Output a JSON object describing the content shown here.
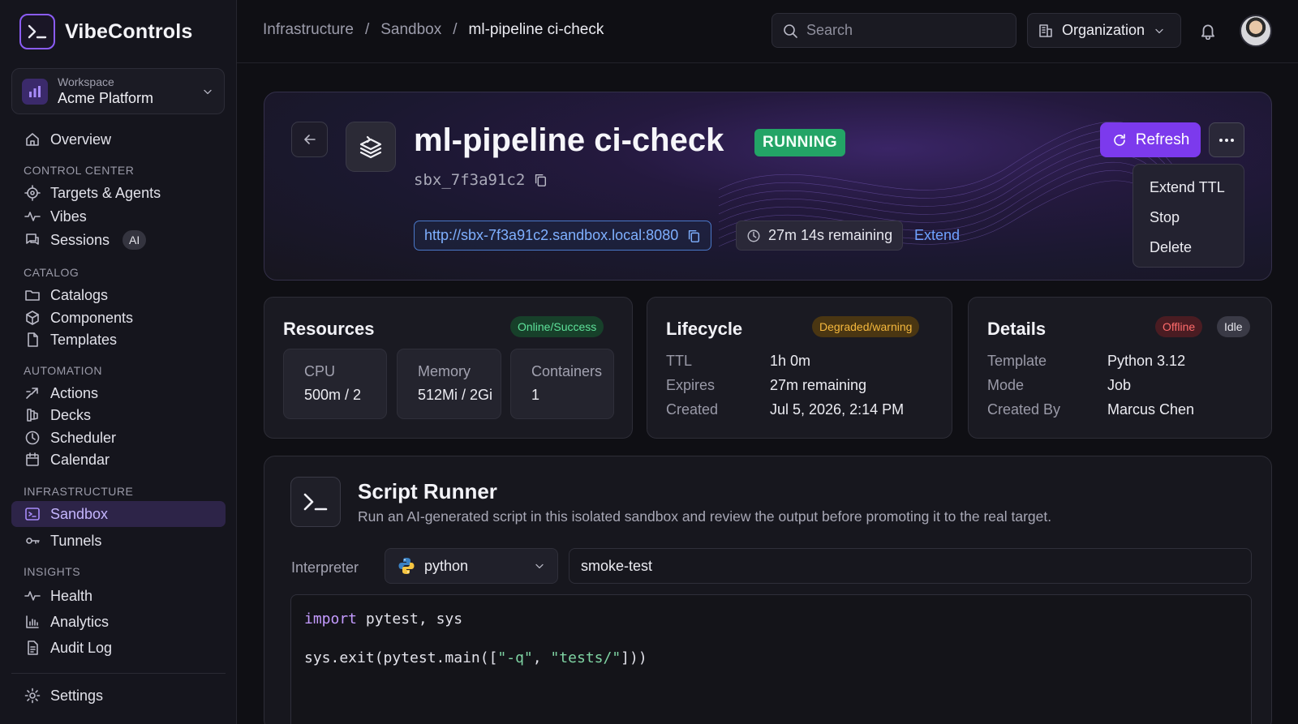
{
  "app": {
    "name": "VibeControls"
  },
  "workspace": {
    "label": "Workspace",
    "name": "Acme Platform"
  },
  "nav": {
    "overview": "Overview",
    "sections": {
      "control_center": "CONTROL CENTER",
      "catalog": "CATALOG",
      "automation": "AUTOMATION",
      "infrastructure": "INFRASTRUCTURE",
      "insights": "INSIGHTS"
    },
    "items": {
      "targets": "Targets & Agents",
      "vibes": "Vibes",
      "sessions": "Sessions",
      "sessions_badge": "AI",
      "catalogs": "Catalogs",
      "components": "Components",
      "templates": "Templates",
      "actions": "Actions",
      "decks": "Decks",
      "scheduler": "Scheduler",
      "calendar": "Calendar",
      "sandbox": "Sandbox",
      "tunnels": "Tunnels",
      "health": "Health",
      "analytics": "Analytics",
      "audit_log": "Audit Log",
      "settings": "Settings"
    }
  },
  "breadcrumb": [
    "Infrastructure",
    "Sandbox",
    "ml-pipeline ci-check"
  ],
  "breadcrumb_sep": "/",
  "search": {
    "placeholder": "Search"
  },
  "org": {
    "label": "Organization"
  },
  "sandbox": {
    "title": "ml-pipeline ci-check",
    "status": "RUNNING",
    "id": "sbx_7f3a91c2",
    "url": "http://sbx-7f3a91c2.sandbox.local:8080",
    "remaining": "27m 14s remaining",
    "extend": "Extend",
    "refresh": "Refresh",
    "menu": [
      "Extend TTL",
      "Stop",
      "Delete"
    ]
  },
  "resources": {
    "title": "Resources",
    "badge": "Online/Success",
    "cpu_label": "CPU",
    "cpu_value": "500m / 2",
    "memory_label": "Memory",
    "memory_value": "512Mi / 2Gi",
    "containers_label": "Containers",
    "containers_value": "1"
  },
  "lifecycle": {
    "title": "Lifecycle",
    "badge": "Degraded/warning",
    "ttl_label": "TTL",
    "ttl_value": "1h 0m",
    "expires_label": "Expires",
    "expires_value": "27m remaining",
    "created_label": "Created",
    "created_value": "Jul 5, 2026, 2:14 PM"
  },
  "details": {
    "title": "Details",
    "badge_offline": "Offline",
    "badge_idle": "Idle",
    "template_label": "Template",
    "template_value": "Python 3.12",
    "mode_label": "Mode",
    "mode_value": "Job",
    "created_by_label": "Created By",
    "created_by_value": "Marcus Chen"
  },
  "runner": {
    "title": "Script Runner",
    "description": "Run an AI-generated script in this isolated sandbox and review the output before promoting it to the real target.",
    "interpreter_label": "Interpreter",
    "interpreter_value": "python",
    "script_name": "smoke-test",
    "code": {
      "line1_kw": "import",
      "line1_rest": " pytest, sys",
      "line2_a": "sys.exit(pytest.main([",
      "line2_s1": "\"-q\"",
      "line2_b": ", ",
      "line2_s2": "\"tests/\"",
      "line2_c": "]))"
    }
  },
  "colors": {
    "accent": "#7c3aed",
    "running": "#23a466",
    "link": "#6fa1ff",
    "success": "#3ddc84",
    "warning": "#f5b83d",
    "offline": "#ff6b6b"
  }
}
